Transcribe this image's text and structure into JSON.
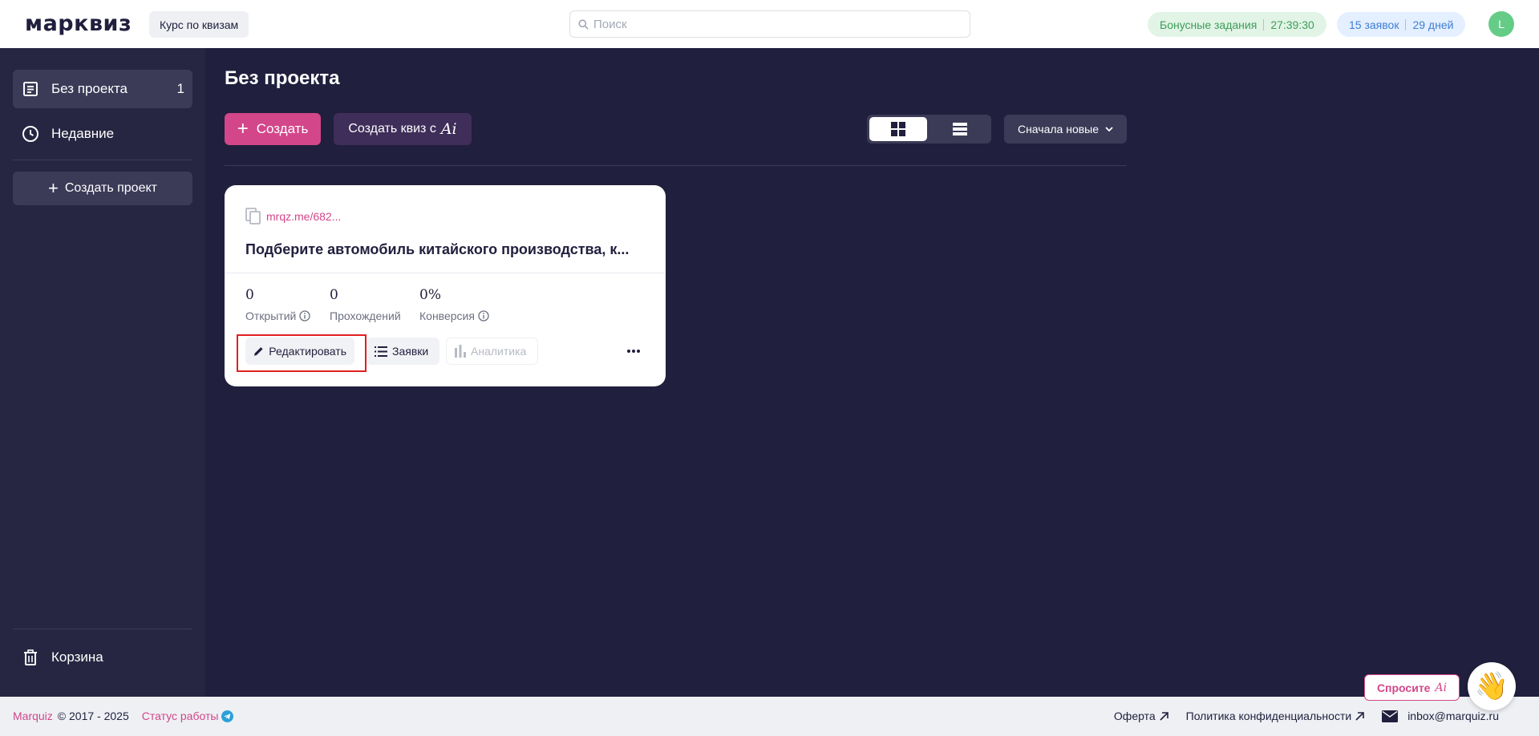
{
  "header": {
    "logo": "марквиз",
    "course_button": "Курс по квизам",
    "search_placeholder": "Поиск",
    "bonus_label": "Бонусные задания",
    "bonus_timer": "27:39:30",
    "leads_count": "15 заявок",
    "days_left": "29 дней",
    "avatar_letter": "L"
  },
  "sidebar": {
    "items": [
      {
        "label": "Без проекта",
        "count": "1",
        "icon": "document-icon"
      },
      {
        "label": "Недавние",
        "icon": "clock-icon"
      }
    ],
    "create_project": "Создать проект",
    "trash": "Корзина"
  },
  "main": {
    "title": "Без проекта",
    "create_button": "Создать",
    "create_ai_button": "Создать квиз с",
    "ai_mark": "Ai",
    "sort_label": "Сначала новые"
  },
  "card": {
    "link": "mrqz.me/682...",
    "title": "Подберите автомобиль китайского производства, к...",
    "stats": [
      {
        "value": "0",
        "label": "Открытий"
      },
      {
        "value": "0",
        "label": "Прохождений"
      },
      {
        "value": "0%",
        "label": "Конверсия"
      }
    ],
    "edit_button": "Редактировать",
    "leads_button": "Заявки",
    "analytics_button": "Аналитика"
  },
  "footer": {
    "brand": "Marquiz",
    "copyright": "© 2017 - 2025",
    "status": "Статус работы",
    "offer": "Оферта",
    "privacy": "Политика конфиденциальности",
    "email": "inbox@marquiz.ru"
  },
  "widget": {
    "ask_label": "Спросите",
    "ask_ai": "Ai",
    "wave": "👋"
  },
  "colors": {
    "accent": "#d3468a",
    "background": "#201f3d",
    "sidebar": "#272642"
  }
}
